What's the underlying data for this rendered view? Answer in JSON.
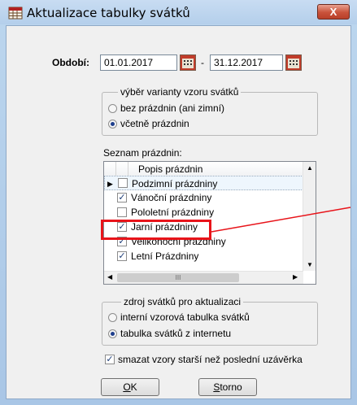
{
  "window": {
    "title": "Aktualizace tabulky svátků",
    "close_label": "X"
  },
  "period": {
    "label": "Období:",
    "from": "01.01.2017",
    "separator": "-",
    "to": "31.12.2017"
  },
  "variant_group": {
    "title": "výběr varianty vzoru svátků",
    "options": [
      {
        "label": "bez prázdnin (ani zimní)",
        "selected": false
      },
      {
        "label": "včetně prázdnin",
        "selected": true
      }
    ]
  },
  "holiday_list": {
    "label": "Seznam prázdnin:",
    "column_header": "Popis prázdnin",
    "rows": [
      {
        "label": "Podzimní prázdniny",
        "checked": false,
        "current": true
      },
      {
        "label": "Vánoční prázdniny",
        "checked": true
      },
      {
        "label": "Pololetní prázdniny",
        "checked": false
      },
      {
        "label": "Jarní prázdniny",
        "checked": true
      },
      {
        "label": "Velikonoční prázdniny",
        "checked": true
      },
      {
        "label": "Letní Prázdniny",
        "checked": true
      }
    ],
    "hscroll_thumb": "III"
  },
  "source_group": {
    "title": "zdroj svátků pro aktualizaci",
    "options": [
      {
        "label": "interní vzorová tabulka svátků",
        "selected": false
      },
      {
        "label": "tabulka svátků z internetu",
        "selected": true
      }
    ]
  },
  "delete_option": {
    "label": "smazat vzory starší než poslední uzávěrka",
    "checked": true
  },
  "buttons": {
    "ok_hotkey": "O",
    "ok_rest": "K",
    "cancel_hotkey": "S",
    "cancel_rest": "torno"
  },
  "colors": {
    "highlight": "#e8141a",
    "checkmark": "#1d3d78",
    "selection_row": "#eef6fd"
  }
}
